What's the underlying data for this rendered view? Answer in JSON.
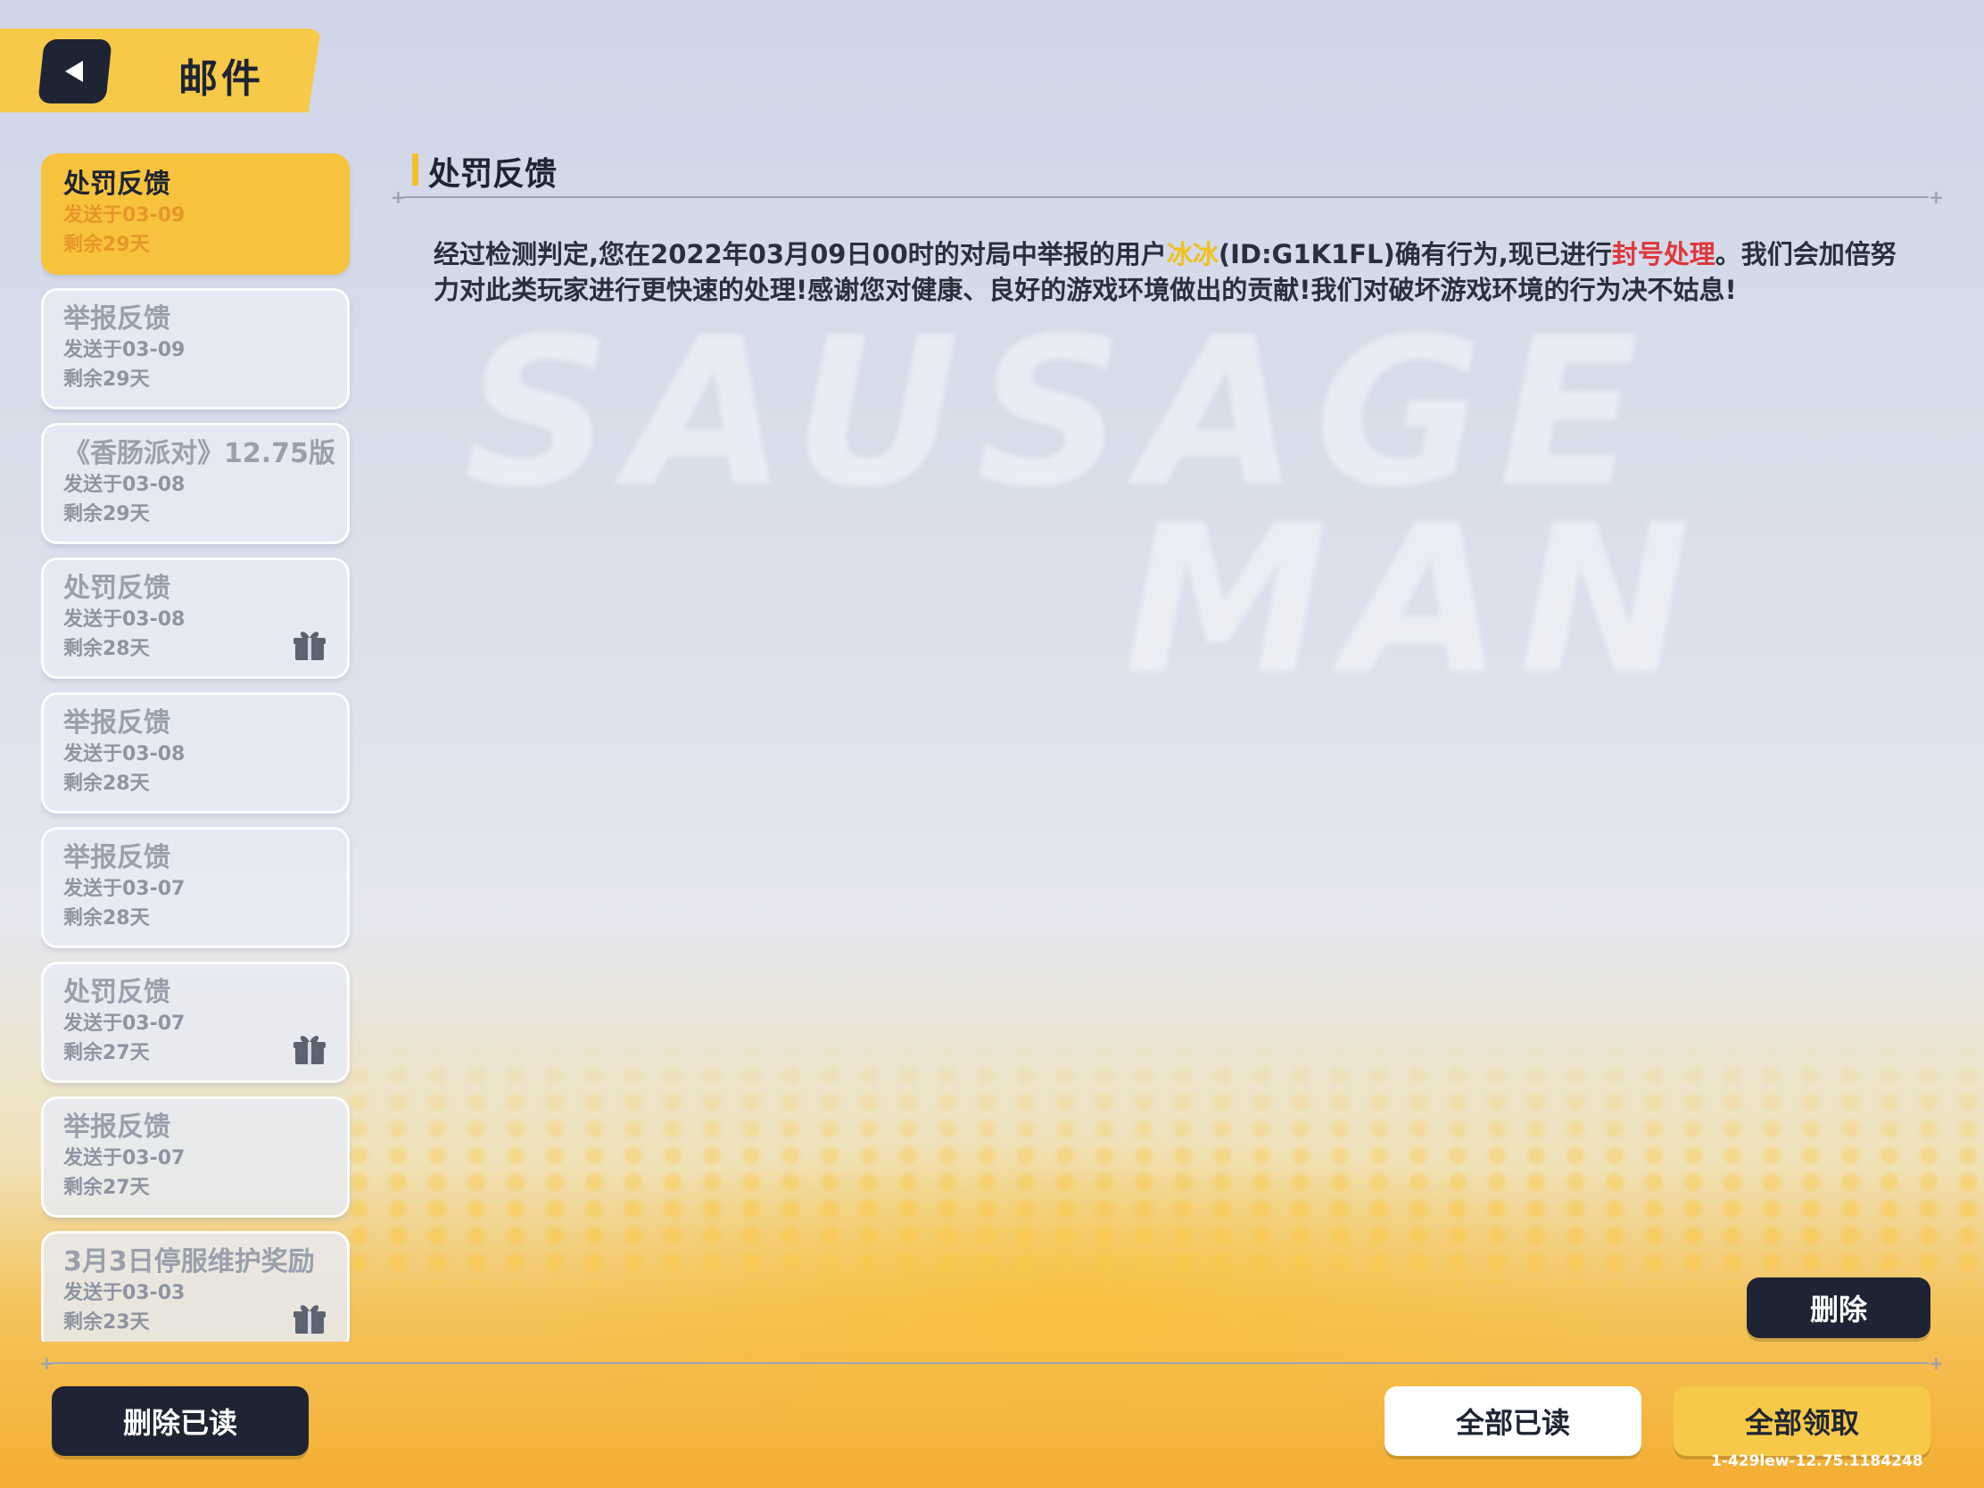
{
  "header": {
    "title": "邮件"
  },
  "watermark": {
    "line1": "SAUSAGE",
    "line2": "MAN"
  },
  "mails": [
    {
      "title": "处罚反馈",
      "sent": "发送于03-09",
      "remaining": "剩余29天",
      "selected": true,
      "has_gift": false
    },
    {
      "title": "举报反馈",
      "sent": "发送于03-09",
      "remaining": "剩余29天",
      "selected": false,
      "has_gift": false
    },
    {
      "title": "《香肠派对》12.75版",
      "sent": "发送于03-08",
      "remaining": "剩余29天",
      "selected": false,
      "has_gift": false
    },
    {
      "title": "处罚反馈",
      "sent": "发送于03-08",
      "remaining": "剩余28天",
      "selected": false,
      "has_gift": true
    },
    {
      "title": "举报反馈",
      "sent": "发送于03-08",
      "remaining": "剩余28天",
      "selected": false,
      "has_gift": false
    },
    {
      "title": "举报反馈",
      "sent": "发送于03-07",
      "remaining": "剩余28天",
      "selected": false,
      "has_gift": false
    },
    {
      "title": "处罚反馈",
      "sent": "发送于03-07",
      "remaining": "剩余27天",
      "selected": false,
      "has_gift": true
    },
    {
      "title": "举报反馈",
      "sent": "发送于03-07",
      "remaining": "剩余27天",
      "selected": false,
      "has_gift": false
    },
    {
      "title": "3月3日停服维护奖励",
      "sent": "发送于03-03",
      "remaining": "剩余23天",
      "selected": false,
      "has_gift": true
    }
  ],
  "content": {
    "title": "处罚反馈",
    "body_part1": "经过检测判定,您在2022年03月09日00时的对局中举报的用户",
    "user_name": "冰冰",
    "body_part2": "(ID:G1K1FL)确有行为,现已进行",
    "penalty": "封号处理",
    "body_part3": "。我们会加倍努力对此类玩家进行更快速的处理!感谢您对健康、良好的游戏环境做出的贡献!我们对破坏游戏环境的行为决不姑息!"
  },
  "buttons": {
    "delete": "删除",
    "delete_read": "删除已读",
    "read_all": "全部已读",
    "claim_all": "全部领取"
  },
  "version": "1-429lew-12.75.1184248",
  "colors": {
    "accent_yellow": "#f7c948",
    "dark": "#1e2433",
    "highlight_yellow": "#f0c11f",
    "highlight_red": "#e0373a"
  }
}
